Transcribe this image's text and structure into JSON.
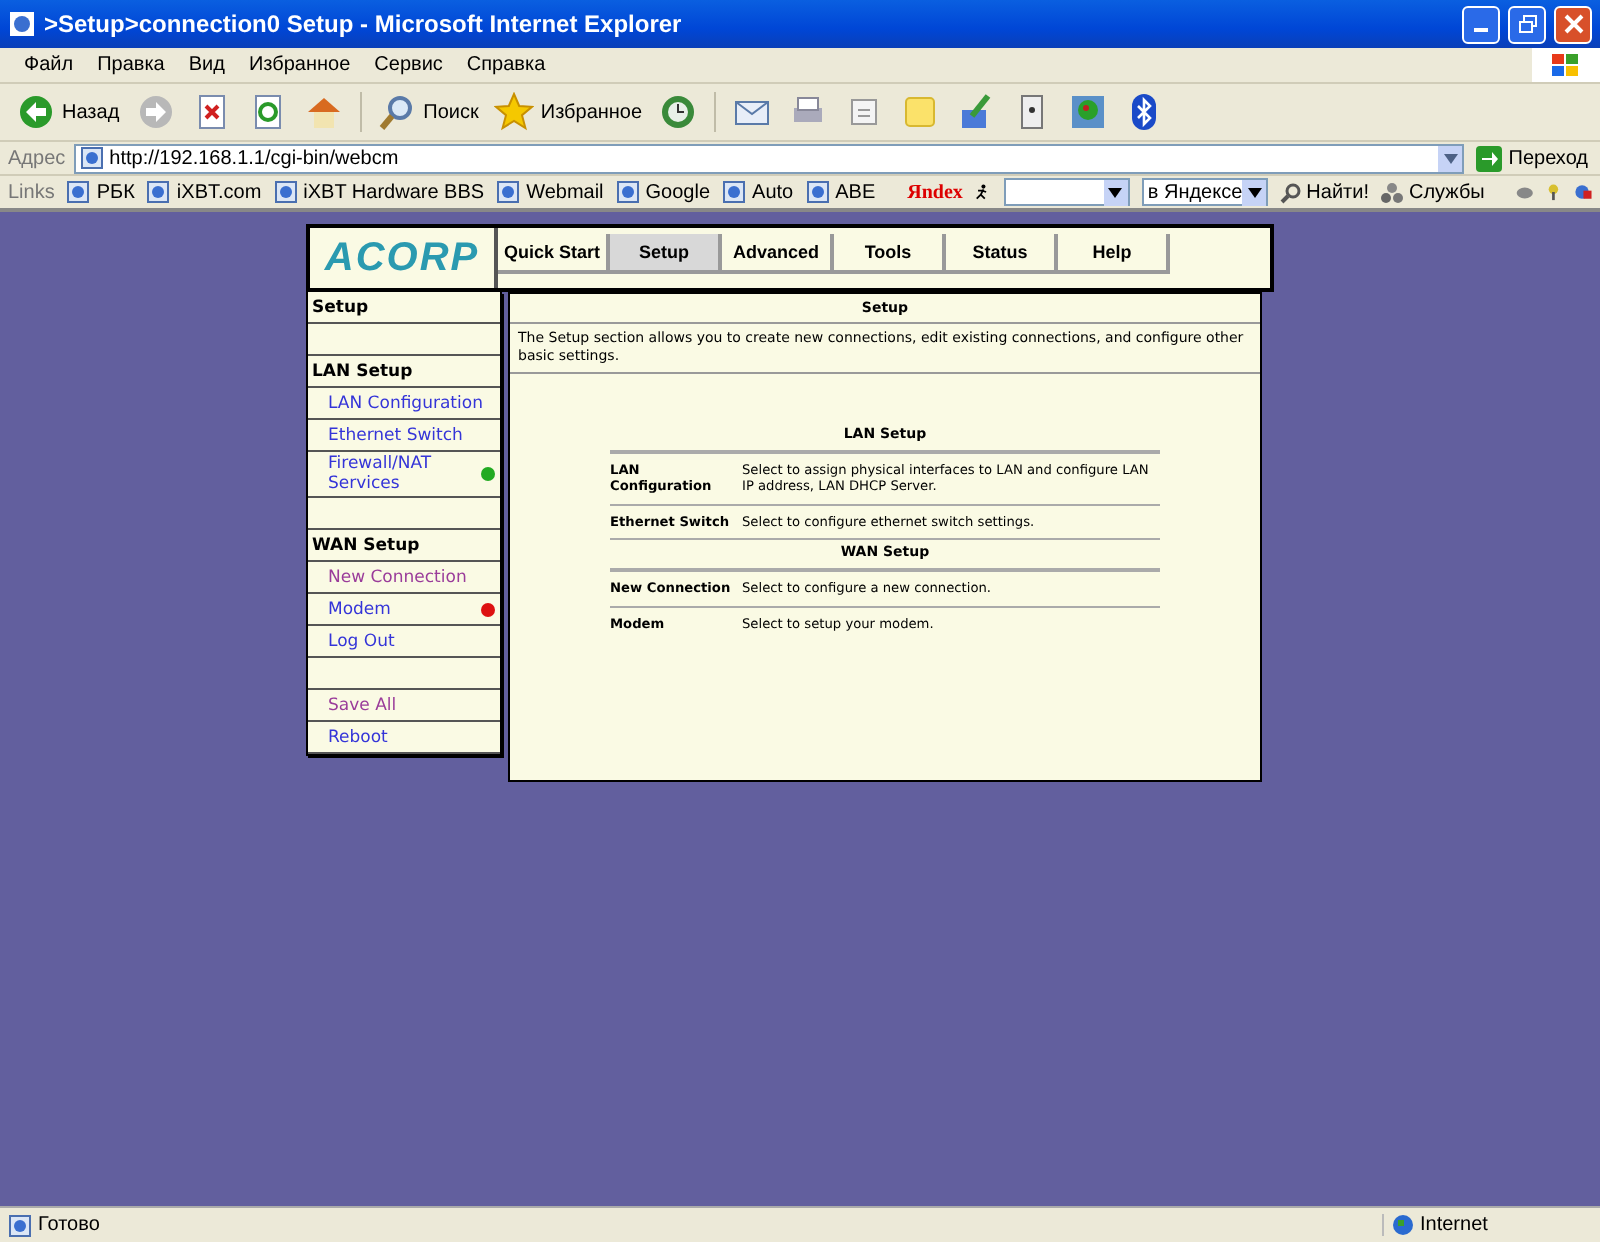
{
  "window": {
    "title": ">Setup>connection0 Setup - Microsoft Internet Explorer"
  },
  "menu": [
    "Файл",
    "Правка",
    "Вид",
    "Избранное",
    "Сервис",
    "Справка"
  ],
  "toolbar": [
    {
      "kind": "back",
      "label": "Назад"
    },
    {
      "kind": "forward"
    },
    {
      "kind": "stop"
    },
    {
      "kind": "refresh"
    },
    {
      "kind": "home"
    },
    {
      "kind": "search",
      "label": "Поиск"
    },
    {
      "kind": "favorites",
      "label": "Избранное"
    },
    {
      "kind": "history"
    },
    {
      "kind": "mail"
    },
    {
      "kind": "print"
    },
    {
      "kind": "edit"
    },
    {
      "kind": "note"
    },
    {
      "kind": "pen"
    },
    {
      "kind": "device"
    },
    {
      "kind": "plant"
    },
    {
      "kind": "bluetooth"
    }
  ],
  "address": {
    "label": "Адрес",
    "value": "http://192.168.1.1/cgi-bin/webcm",
    "go": "Переход"
  },
  "links": {
    "label": "Links",
    "items": [
      "РБК",
      "iXBT.com",
      "iXBT Hardware BBS",
      "Webmail",
      "Google",
      "Auto",
      "ABE"
    ]
  },
  "yandex": {
    "logo": "Яndex",
    "scope": "в Яндексе",
    "find": "Найти!",
    "services": "Службы"
  },
  "router": {
    "logo": "ACORP",
    "tabs": [
      {
        "label": "Quick Start",
        "selected": false
      },
      {
        "label": "Setup",
        "selected": true
      },
      {
        "label": "Advanced",
        "selected": false
      },
      {
        "label": "Tools",
        "selected": false
      },
      {
        "label": "Status",
        "selected": false
      },
      {
        "label": "Help",
        "selected": false
      }
    ],
    "sidebar": [
      {
        "kind": "heading",
        "label": "Setup"
      },
      {
        "kind": "spacer"
      },
      {
        "kind": "heading",
        "label": "LAN Setup"
      },
      {
        "kind": "link",
        "label": "LAN Configuration",
        "visited": false
      },
      {
        "kind": "link",
        "label": "Ethernet Switch",
        "visited": false
      },
      {
        "kind": "link",
        "label": "Firewall/NAT Services",
        "visited": false,
        "color": "#22aa22"
      },
      {
        "kind": "spacer"
      },
      {
        "kind": "heading",
        "label": "WAN Setup"
      },
      {
        "kind": "link",
        "label": "New Connection",
        "visited": true
      },
      {
        "kind": "link",
        "label": "Modem",
        "visited": false,
        "color": "#dd1111"
      },
      {
        "kind": "link",
        "label": "Log Out",
        "visited": false
      },
      {
        "kind": "spacer"
      },
      {
        "kind": "link",
        "label": "Save All",
        "visited": true
      },
      {
        "kind": "link",
        "label": "Reboot",
        "visited": false
      }
    ],
    "content": {
      "title": "Setup",
      "intro": "The Setup section allows you to create new connections, edit existing connections, and configure other basic settings.",
      "sections": [
        {
          "title": "LAN Setup",
          "rows": [
            {
              "name": "LAN Configuration",
              "description": "Select to assign physical interfaces to LAN and configure LAN IP address, LAN DHCP Server."
            },
            {
              "name": "Ethernet Switch",
              "description": "Select to configure ethernet switch settings."
            }
          ]
        },
        {
          "title": "WAN Setup",
          "rows": [
            {
              "name": "New Connection",
              "description": "Select to configure a new connection."
            },
            {
              "name": "Modem",
              "description": "Select to setup your modem."
            }
          ]
        }
      ]
    }
  },
  "status_bar": {
    "text": "Готово",
    "zone": "Internet"
  }
}
